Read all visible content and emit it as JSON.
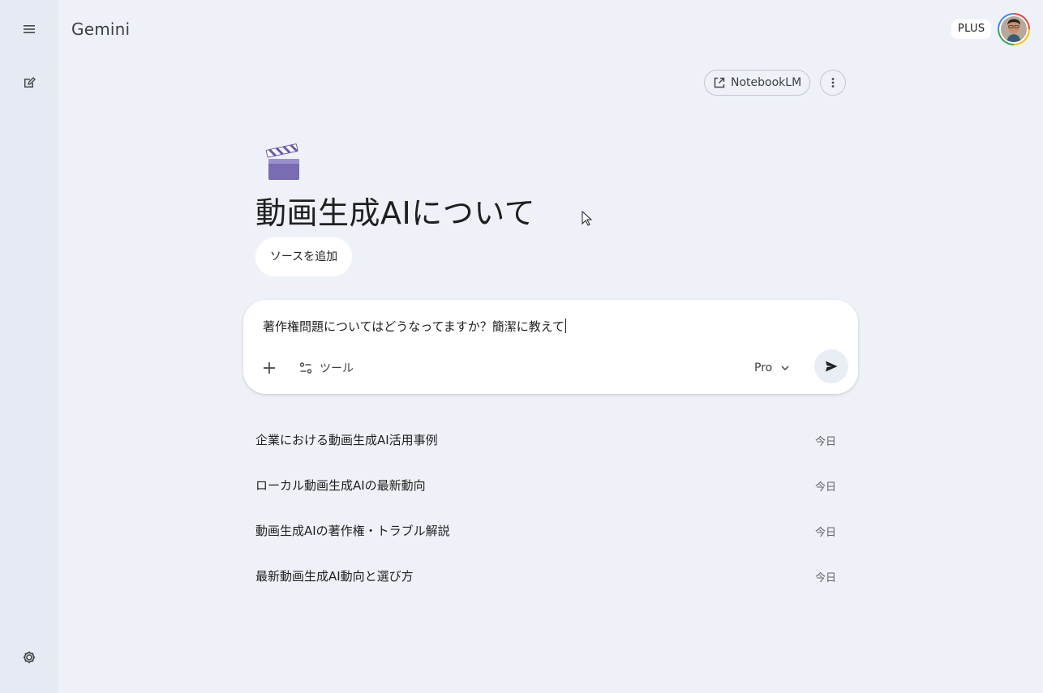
{
  "app": {
    "brand": "Gemini"
  },
  "header": {
    "plan_badge": "PLUS",
    "avatar_icon": "user-avatar"
  },
  "sidebar": {
    "menu_icon": "menu-icon",
    "new_chat_icon": "new-chat-icon",
    "settings_icon": "settings-icon"
  },
  "notebook": {
    "notebooklm_label": "NotebookLM",
    "notebooklm_icon": "open-in-new-icon",
    "more_icon": "more-vert-icon"
  },
  "gem": {
    "emoji_icon": "clapper-board-icon",
    "title": "動画生成AIについて",
    "add_source_label": "ソースを追加"
  },
  "composer": {
    "input_value": "著作権問題についてはどうなってますか？簡潔に教えて",
    "add_icon": "plus-icon",
    "tools_label": "ツール",
    "tools_icon": "tools-icon",
    "model_label": "Pro",
    "model_icon": "chevron-down-icon",
    "send_icon": "send-icon"
  },
  "history": {
    "items": [
      {
        "title": "企業における動画生成AI活用事例",
        "date": "今日"
      },
      {
        "title": "ローカル動画生成AIの最新動向",
        "date": "今日"
      },
      {
        "title": "動画生成AIの著作権・トラブル解説",
        "date": "今日"
      },
      {
        "title": "最新動画生成AI動向と選び方",
        "date": "今日"
      }
    ]
  },
  "colors": {
    "page_bg": "#eef2f8",
    "rail_bg": "#e6ebf3",
    "surface": "#ffffff",
    "text_primary": "#1f1f1f",
    "text_secondary": "#5f6368"
  }
}
